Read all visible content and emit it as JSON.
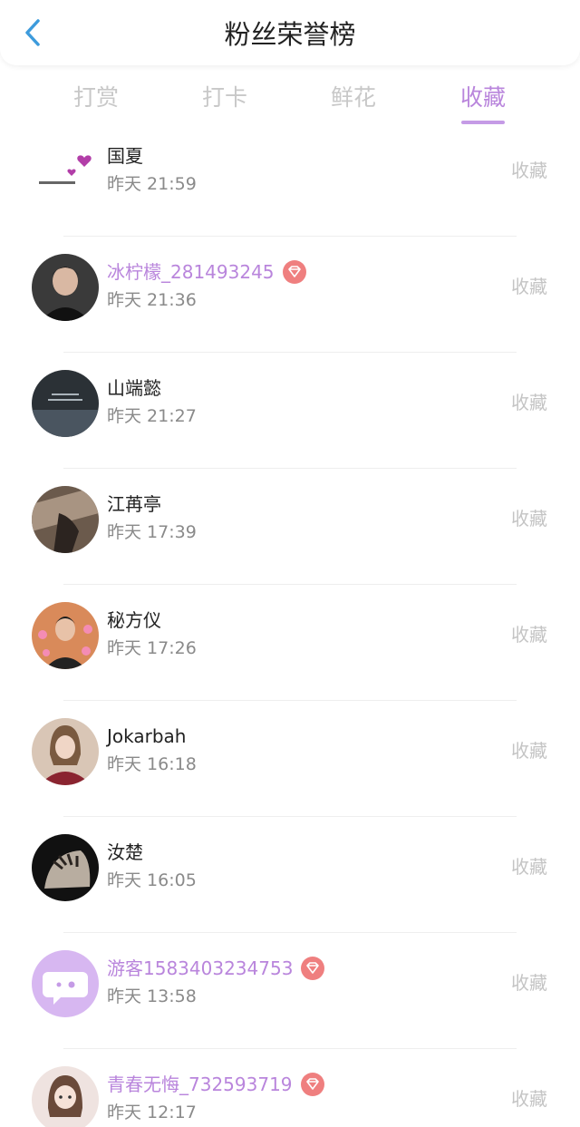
{
  "header": {
    "title": "粉丝荣誉榜"
  },
  "tabs": [
    {
      "label": "打赏",
      "active": false
    },
    {
      "label": "打卡",
      "active": false
    },
    {
      "label": "鲜花",
      "active": false
    },
    {
      "label": "收藏",
      "active": true
    }
  ],
  "colors": {
    "accent": "#b985dc",
    "badge": "#ef7f7f",
    "text": "#222222",
    "muted": "#8a8a8a",
    "action": "#c4c4c4"
  },
  "list": [
    {
      "name": "国夏",
      "time": "昨天 21:59",
      "action": "收藏",
      "vip": false,
      "avatar": "hearts-sticker-avatar"
    },
    {
      "name": "冰柠檬_281493245",
      "time": "昨天 21:36",
      "action": "收藏",
      "vip": true,
      "avatar": "portrait-avatar"
    },
    {
      "name": "山端懿",
      "time": "昨天 21:27",
      "action": "收藏",
      "vip": false,
      "avatar": "dark-scene-avatar"
    },
    {
      "name": "江苒亭",
      "time": "昨天 17:39",
      "action": "收藏",
      "vip": false,
      "avatar": "sepia-scene-avatar"
    },
    {
      "name": "秘方仪",
      "time": "昨天 17:26",
      "action": "收藏",
      "vip": false,
      "avatar": "hearts-portrait-avatar"
    },
    {
      "name": "Jokarbah",
      "time": "昨天 16:18",
      "action": "收藏",
      "vip": false,
      "avatar": "girl-portrait-avatar"
    },
    {
      "name": "汝楚",
      "time": "昨天 16:05",
      "action": "收藏",
      "vip": false,
      "avatar": "tiger-avatar"
    },
    {
      "name": "游客1583403234753",
      "time": "昨天 13:58",
      "action": "收藏",
      "vip": true,
      "avatar": "default-chat-avatar"
    },
    {
      "name": "青春无悔_732593719",
      "time": "昨天 12:17",
      "action": "收藏",
      "vip": true,
      "avatar": "cartoon-girl-avatar"
    }
  ]
}
